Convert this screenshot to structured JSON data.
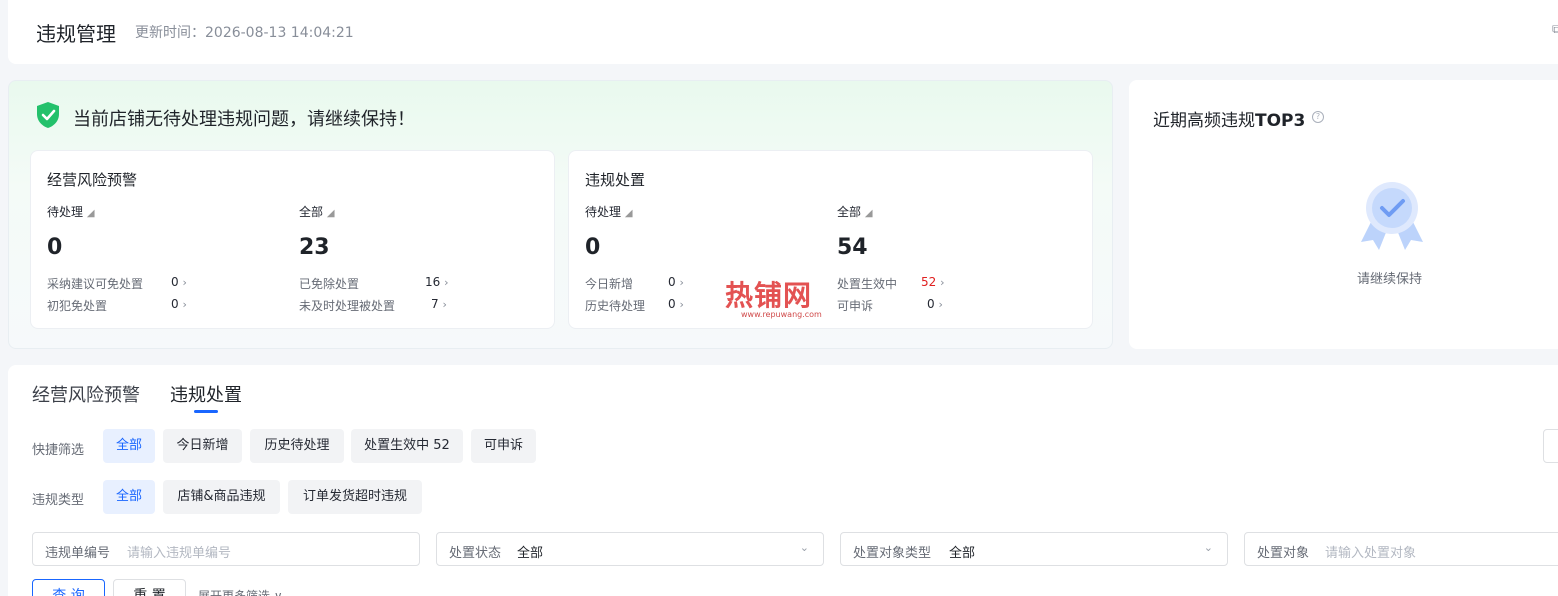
{
  "header": {
    "title": "违规管理",
    "update_time": "更新时间：2026-08-13 14:04:21",
    "edge_icon": "copy-icon"
  },
  "summary": {
    "banner": "当前店铺无待处理违规问题，请继续保持！",
    "banner_icon": "shield-check-icon",
    "risk": {
      "title": "经营风险预警",
      "pending_label": "待处理",
      "pending_value": "0",
      "all_label": "全部",
      "all_value": "23",
      "rows_left": [
        {
          "label": "采纳建议可免处置",
          "value": "0"
        },
        {
          "label": "初犯免处置",
          "value": "0"
        }
      ],
      "rows_right": [
        {
          "label": "已免除处置",
          "value": "16"
        },
        {
          "label": "未及时处理被处置",
          "value": "7"
        }
      ]
    },
    "violation": {
      "title": "违规处置",
      "pending_label": "待处理",
      "pending_value": "0",
      "all_label": "全部",
      "all_value": "54",
      "rows_left": [
        {
          "label": "今日新增",
          "value": "0"
        },
        {
          "label": "历史待处理",
          "value": "0"
        }
      ],
      "rows_right": [
        {
          "label": "处置生效中",
          "value": "52"
        },
        {
          "label": "可申诉",
          "value": "0"
        }
      ]
    }
  },
  "top3": {
    "title_prefix": "近期高频违规",
    "title_bold": "TOP3",
    "help": "?",
    "empty_text": "请继续保持"
  },
  "tabs": [
    {
      "label": "经营风险预警"
    },
    {
      "label": "违规处置"
    }
  ],
  "filters": {
    "quick_label": "快捷筛选",
    "quick": [
      "全部",
      "今日新增",
      "历史待处理",
      "处置生效中 52",
      "可申诉"
    ],
    "type_label": "违规类型",
    "types": [
      "全部",
      "店铺&商品违规",
      "订单发货超时违规"
    ],
    "fields": [
      {
        "label": "违规单编号",
        "placeholder": "请输入违规单编号"
      },
      {
        "label": "处置状态",
        "value": "全部"
      },
      {
        "label": "处置对象类型",
        "value": "全部"
      },
      {
        "label": "处置对象",
        "placeholder": "请输入处置对象"
      }
    ],
    "query_button": "查 询",
    "reset_button": "重 置",
    "more": "展开更多筛选 ∨"
  },
  "watermark": {
    "text": "热铺网",
    "url": "www.repuwang.com"
  },
  "colors": {
    "accent": "#1966ff",
    "success": "#22c55e",
    "danger": "#e02020"
  }
}
